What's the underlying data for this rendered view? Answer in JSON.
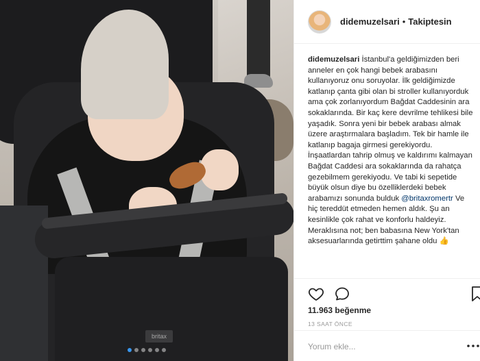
{
  "post": {
    "username": "didemuzelsari",
    "separator": "•",
    "follow_status": "Takiptesin",
    "caption_username": "didemuzelsari",
    "caption_part1": "İstanbul'a geldiğimizden beri anneler en çok hangi bebek arabasını kullanıyoruz onu soruyolar. İlk geldiğimizde katlanıp çanta gibi olan bi stroller kullanıyorduk ama çok zorlanıyordum Bağdat Caddesinin ara sokaklarında. Bir kaç kere devrilme tehlikesi bile yaşadık. Sonra yeni bir bebek arabası almak üzere araştırmalara başladım. Tek bir hamle ile katlanıp bagaja girmesi gerekiyordu. İnşaatlardan tahrip olmuş ve kaldırımı kalmayan Bağdat Caddesi ara sokaklarında da rahatça gezebilmem gerekiyodu. Ve tabi ki sepetide büyük olsun diye bu özelliklerdeki bebek arabamızı sonunda bulduk",
    "mention": "@britaxromertr",
    "caption_part2": "Ve hiç tereddüt etmeden hemen aldık. Şu an kesinlikle çok rahat ve konforlu haldeyiz. Meraklısına not; ben babasına New York'tan aksesuarlarında getirttim şahane oldu 👍",
    "likes_count": "11.963",
    "likes_label": "beğenme",
    "time_ago": "13 SAAT ÖNCE",
    "comment_placeholder": "Yorum ekle..."
  },
  "photo": {
    "brand_tag": "britax",
    "carousel_total": 6,
    "carousel_active": 1
  },
  "icons": {
    "like": "heart-icon",
    "comment": "comment-icon",
    "share": "bookmark-icon",
    "more": "more-icon"
  },
  "colors": {
    "text": "#262626",
    "muted": "#999999",
    "mention": "#003569",
    "border": "#efefef",
    "active_dot": "#3897f0"
  }
}
